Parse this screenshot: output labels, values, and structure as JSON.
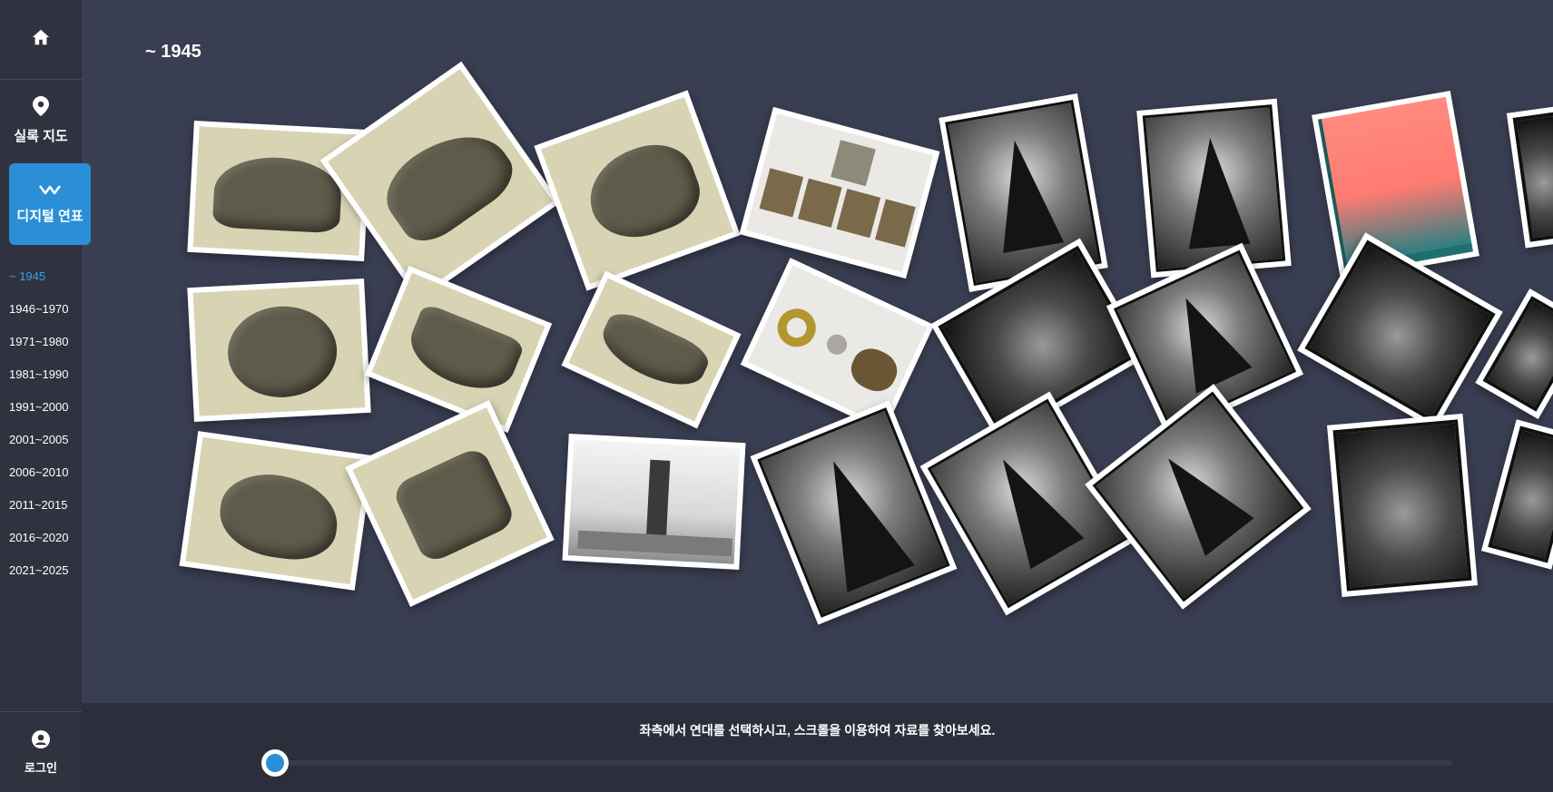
{
  "sidebar": {
    "home_icon": "home-icon",
    "map": {
      "icon": "map-pin-icon",
      "label": "실록 지도"
    },
    "timeline": {
      "icon": "timeline-icon",
      "label": "디지털 연표"
    },
    "eras": [
      "~ 1945",
      "1946~1970",
      "1971~1980",
      "1981~1990",
      "1991~2000",
      "2001~2005",
      "2006~2010",
      "2011~2015",
      "2016~2020",
      "2021~2025"
    ],
    "active_era_index": 0,
    "login": {
      "icon": "user-circle-icon",
      "label": "로그인"
    }
  },
  "main": {
    "era_title": "~ 1945"
  },
  "footer": {
    "hint": "좌측에서 연대를 선택하시고, 스크롤을 이용하여 자료를 찾아보세요.",
    "slider_value": 0
  },
  "colors": {
    "background": "#3a3e52",
    "sidebar": "#30333f",
    "accent": "#2a8fd6",
    "active_era": "#35a3f0",
    "bottom_bar": "#2c2f3b"
  }
}
